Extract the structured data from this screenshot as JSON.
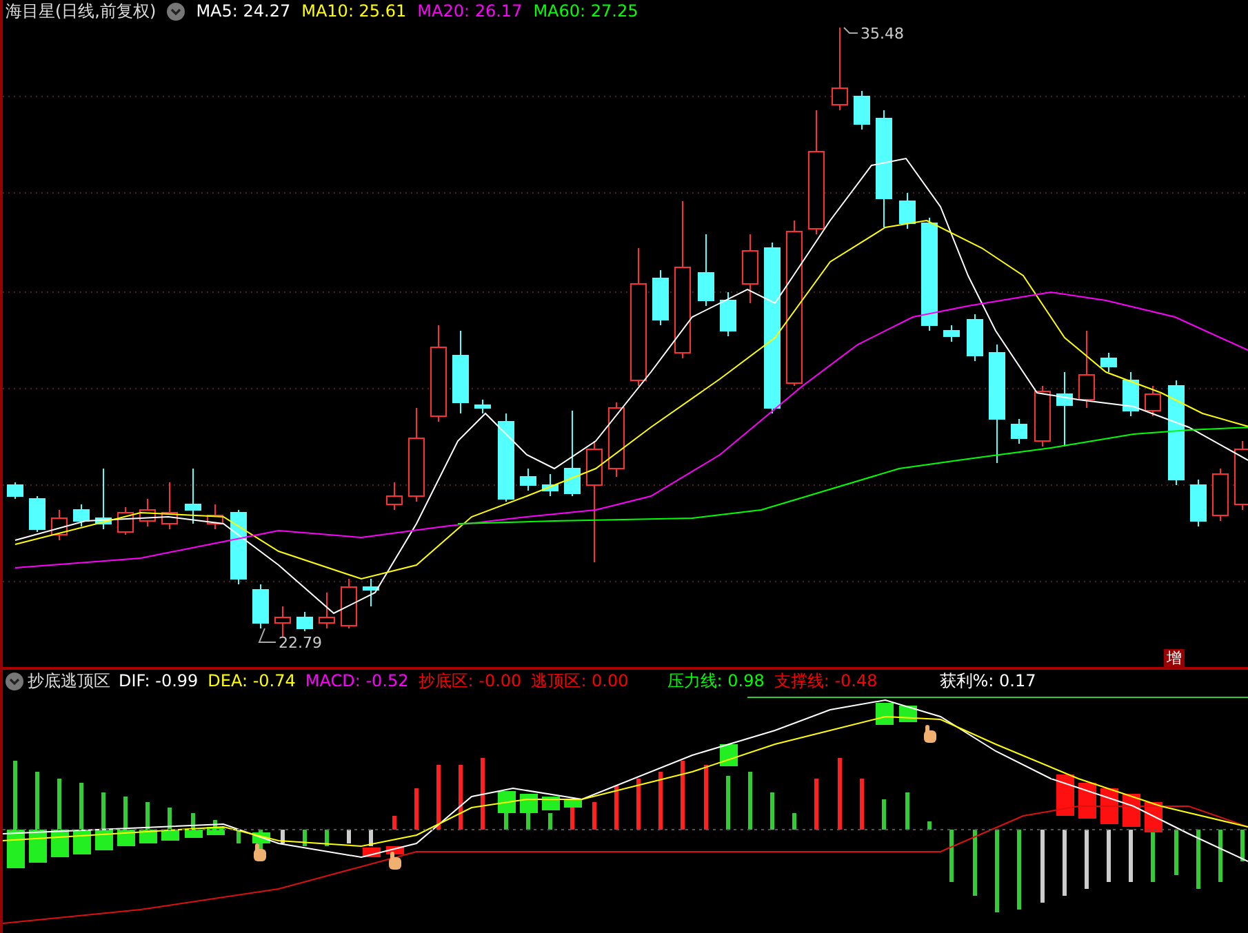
{
  "main_chart": {
    "title": "海目星(日线,前复权)",
    "ma": [
      {
        "label": "MA5: 24.27",
        "color": "#ffffff"
      },
      {
        "label": "MA10: 25.61",
        "color": "#ffff00"
      },
      {
        "label": "MA20: 26.17",
        "color": "#ff00ff"
      },
      {
        "label": "MA60: 27.25",
        "color": "#00ff00"
      }
    ],
    "high_label": "35.48",
    "low_label": "22.79",
    "badge": "增"
  },
  "indicator": {
    "title": "抄底逃顶区",
    "groups": [
      [
        {
          "label": "DIF: -0.99",
          "color": "#ffffff"
        },
        {
          "label": "DEA: -0.74",
          "color": "#ffff00"
        },
        {
          "label": "MACD: -0.52",
          "color": "#ff00ff"
        },
        {
          "label": "抄底区: -0.00",
          "color": "#ff0000"
        },
        {
          "label": "逃顶区: 0.00",
          "color": "#ff0000"
        }
      ],
      [
        {
          "label": "压力线: 0.98",
          "color": "#00ff00"
        },
        {
          "label": "支撑线: -0.48",
          "color": "#ff0000"
        }
      ],
      [
        {
          "label": "获利%: 0.17",
          "color": "#ffffff"
        }
      ]
    ]
  }
}
